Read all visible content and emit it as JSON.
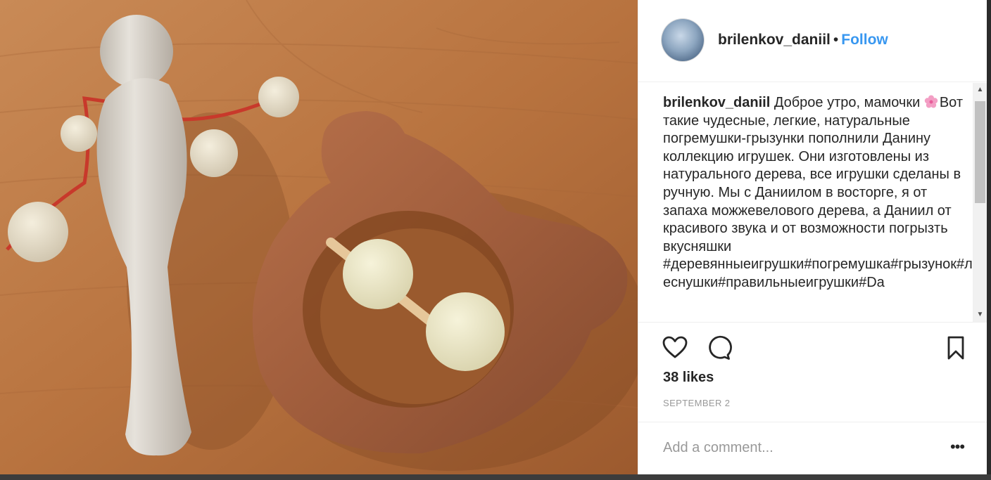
{
  "post": {
    "username": "brilenkov_daniil",
    "separator": "•",
    "follow_label": "Follow",
    "caption": {
      "username": "brilenkov_daniil",
      "text_part1": " Доброе утро, мамочки ",
      "text_part2": "Вот такие чудесные, легкие, натуральные погремушки-грызунки пополнили Данину коллекцию игрушек. Они изготовлены из натурального дерева, все игрушки сделаны в ручную. Мы с Даниилом в восторге, я от запаха можжевелового дерева, а Даниил от красивого звука и от возможности погрызть вкусняшки ",
      "hashtags": "#деревянныеигрушки#погремушка#грызунок#леснушки#правильныеигрушки#Da"
    },
    "likes": "38 likes",
    "date": "SEPTEMBER 2",
    "comment_placeholder": "Add a comment...",
    "more_label": "•••"
  },
  "icons": {
    "avatar": "profile-avatar",
    "flower": "cherry-blossom-emoji",
    "like": "heart-icon",
    "comment": "comment-bubble-icon",
    "save": "bookmark-icon",
    "scroll_up": "scroll-up-arrow",
    "scroll_down": "scroll-down-arrow"
  },
  "colors": {
    "link_blue": "#3897f0",
    "text": "#262626",
    "muted": "#999999"
  }
}
